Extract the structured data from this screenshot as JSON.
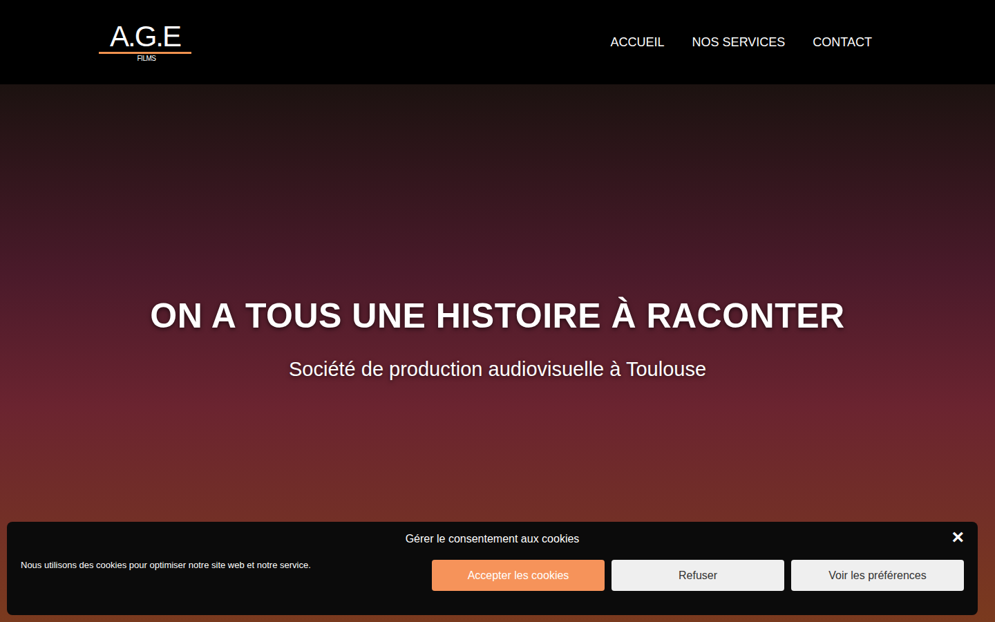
{
  "header": {
    "logo": {
      "title": "A.G.E",
      "subtitle": "FILMS"
    },
    "nav": [
      {
        "label": "ACCUEIL"
      },
      {
        "label": "NOS SERVICES"
      },
      {
        "label": "CONTACT"
      }
    ]
  },
  "hero": {
    "title": "ON A TOUS UNE HISTOIRE À RACONTER",
    "subtitle": "Société de production audiovisuelle à Toulouse"
  },
  "cookie_banner": {
    "title": "Gérer le consentement aux cookies",
    "close": "×",
    "message": "Nous utilisons des cookies pour optimiser notre site web et notre service.",
    "buttons": [
      {
        "label": "Accepter les cookies",
        "kind": "primary"
      },
      {
        "label": "Refuser",
        "kind": "secondary"
      },
      {
        "label": "Voir les préférences",
        "kind": "secondary"
      }
    ]
  }
}
